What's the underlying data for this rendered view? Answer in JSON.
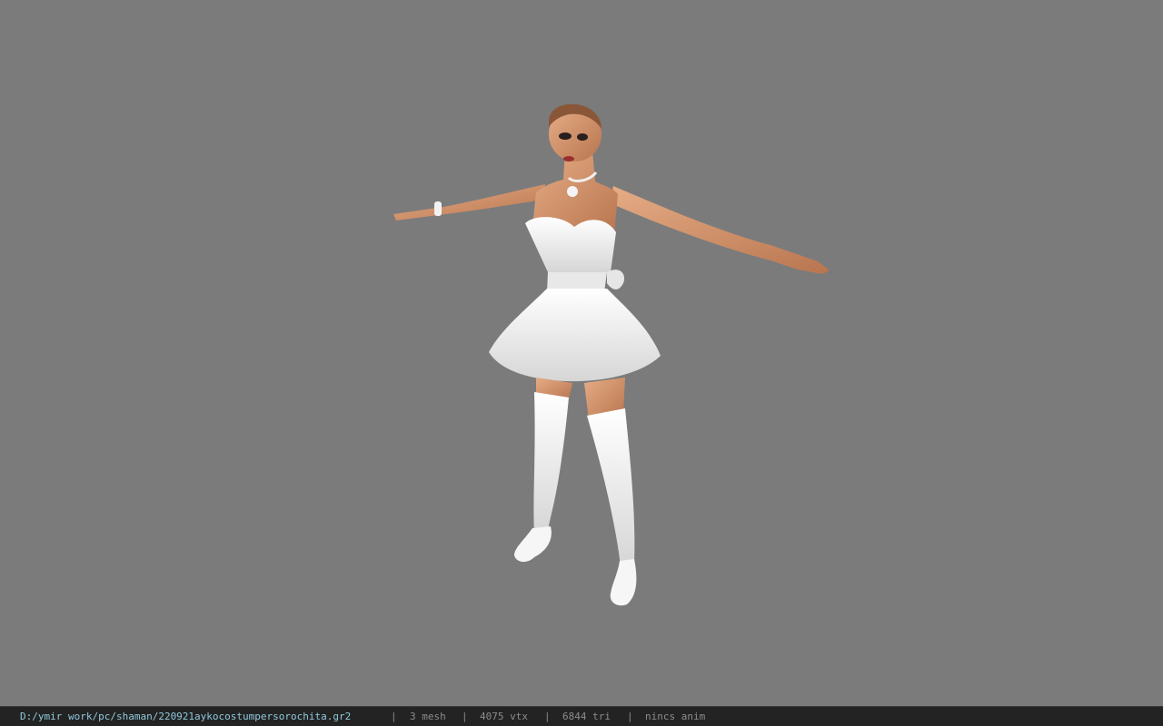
{
  "viewport": {
    "background_color": "#7b7b7b",
    "model_description_icon": "character-model"
  },
  "statusbar": {
    "file_path": "D:/ymir work/pc/shaman/220921aykocostumpersorochita.gr2",
    "separator": "|",
    "mesh_count": "3 mesh",
    "vertex_count": "4075 vtx",
    "triangle_count": "6844 tri",
    "anim_status": "nincs anim",
    "path_color": "#8fc9dc",
    "text_color": "#8c8c8c"
  }
}
